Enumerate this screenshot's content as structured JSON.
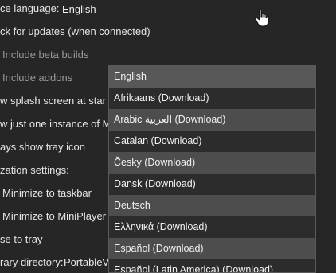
{
  "settings": {
    "language_label": "ce language:",
    "language_value": "English",
    "check_updates": "ck for updates (when connected)",
    "include_beta": "Include beta builds",
    "include_addons": "Include addons",
    "splash_screen": "w splash screen at star",
    "single_instance": "w just one instance of M",
    "tray_icon": "ays show tray icon",
    "minimization_settings": "zation settings:",
    "minimize_taskbar": "Minimize to taskbar",
    "minimize_miniplayer": "Minimize to MiniPlayer",
    "close_tray": "se to tray",
    "library_dir_label": "rary directory:",
    "library_dir_value": "PortableV"
  },
  "dropdown": {
    "options": [
      "English",
      "Afrikaans (Download)",
      "Arabic العربية (Download)",
      "Catalan (Download)",
      "Česky (Download)",
      "Dansk (Download)",
      "Deutsch",
      "Ελληνικά (Download)",
      "Español (Download)",
      "Español (Latin America) (Download)"
    ]
  }
}
